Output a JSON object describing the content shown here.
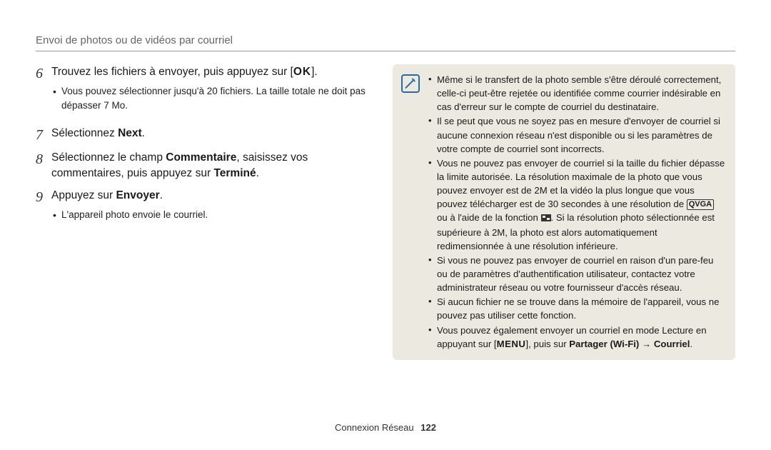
{
  "header": {
    "title": "Envoi de photos ou de vidéos par courriel"
  },
  "steps": [
    {
      "num": "6",
      "line_before": "Trouvez les fichiers à envoyer, puis appuyez sur [",
      "key": "OK",
      "line_after": "].",
      "sub": [
        "Vous pouvez sélectionner jusqu'à 20 fichiers. La taille totale ne doit pas dépasser 7 Mo."
      ]
    },
    {
      "num": "7",
      "text_plain": "Sélectionnez ",
      "bold": "Next",
      "text_after": "."
    },
    {
      "num": "8",
      "seg1": "Sélectionnez le champ ",
      "bold1": "Commentaire",
      "seg2": ", saisissez vos commentaires, puis appuyez sur ",
      "bold2": "Terminé",
      "seg3": "."
    },
    {
      "num": "9",
      "text_plain": "Appuyez sur ",
      "bold": "Envoyer",
      "text_after": ".",
      "sub": [
        "L'appareil photo envoie le courriel."
      ]
    }
  ],
  "info": {
    "items": [
      "Même si le transfert de la photo semble s'être déroulé correctement, celle-ci peut-être rejetée ou identifiée comme courrier indésirable en cas d'erreur sur le compte de courriel du destinataire.",
      "Il se peut que vous ne soyez pas en mesure d'envoyer de courriel si aucune connexion réseau n'est disponible ou si les paramètres de votre compte de courriel sont incorrects."
    ],
    "item3": {
      "a": "Vous ne pouvez pas envoyer de courriel si la taille du fichier dépasse la limite autorisée. La résolution maximale de la photo que vous pouvez envoyer est de 2M et la vidéo la plus longue que vous pouvez télécharger est de 30 secondes à une résolution de ",
      "tag": "QVGA",
      "b": " ou à l'aide de la fonction ",
      "c": ". Si la résolution photo sélectionnée est supérieure à 2M, la photo est alors automatiquement redimensionnée à une résolution inférieure."
    },
    "items_tail": [
      "Si vous ne pouvez pas envoyer de courriel en raison d'un pare-feu ou de paramètres d'authentification utilisateur, contactez votre administrateur réseau ou votre fournisseur d'accès réseau.",
      "Si aucun fichier ne se trouve dans la mémoire de l'appareil, vous ne pouvez pas utiliser cette fonction."
    ],
    "item_last": {
      "a": "Vous pouvez également envoyer un courriel en mode Lecture en appuyant sur [",
      "menu": "MENU",
      "b": "], puis sur ",
      "bold1": "Partager (Wi-Fi)",
      "arrow": " → ",
      "bold2": "Courriel",
      "c": "."
    }
  },
  "footer": {
    "section": "Connexion Réseau",
    "page": "122"
  }
}
